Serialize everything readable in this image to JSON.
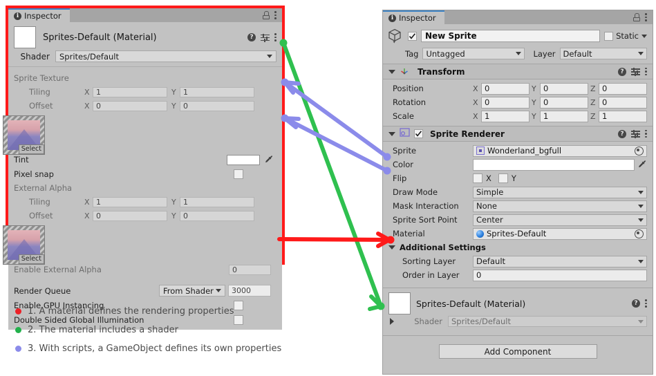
{
  "left_panel": {
    "tab_label": "Inspector",
    "material_title": "Sprites-Default (Material)",
    "shader_label": "Shader",
    "shader_value": "Sprites/Default",
    "sections": {
      "sprite_texture": {
        "label": "Sprite Texture",
        "tiling_label": "Tiling",
        "tiling_x_axis": "X",
        "tiling_x": "1",
        "tiling_y_axis": "Y",
        "tiling_y": "1",
        "offset_label": "Offset",
        "offset_x_axis": "X",
        "offset_x": "0",
        "offset_y_axis": "Y",
        "offset_y": "0",
        "select_label": "Select"
      },
      "tint": {
        "label": "Tint",
        "value": ""
      },
      "pixel_snap": {
        "label": "Pixel snap",
        "checked": false
      },
      "external_alpha": {
        "label": "External Alpha",
        "tiling_label": "Tiling",
        "tiling_x_axis": "X",
        "tiling_x": "1",
        "tiling_y_axis": "Y",
        "tiling_y": "1",
        "offset_label": "Offset",
        "offset_x_axis": "X",
        "offset_x": "0",
        "offset_y_axis": "Y",
        "offset_y": "0",
        "select_label": "Select"
      },
      "enable_external_alpha": {
        "label": "Enable External Alpha",
        "value": "0"
      },
      "render_queue": {
        "label": "Render Queue",
        "mode": "From Shader",
        "value": "3000"
      },
      "enable_gpu_instancing": {
        "label": "Enable GPU Instancing",
        "checked": false
      },
      "double_sided_gi": {
        "label": "Double Sided Global Illumination",
        "checked": false
      }
    }
  },
  "right_panel": {
    "tab_label": "Inspector",
    "gameobject": {
      "name": "New Sprite",
      "enabled": true,
      "static_label": "Static",
      "static_checked": false,
      "tag_label": "Tag",
      "tag_value": "Untagged",
      "layer_label": "Layer",
      "layer_value": "Default"
    },
    "transform": {
      "title": "Transform",
      "rows": [
        {
          "label": "Position",
          "x": "0",
          "y": "0",
          "z": "0"
        },
        {
          "label": "Rotation",
          "x": "0",
          "y": "0",
          "z": "0"
        },
        {
          "label": "Scale",
          "x": "1",
          "y": "1",
          "z": "1"
        }
      ],
      "axis_x": "X",
      "axis_y": "Y",
      "axis_z": "Z"
    },
    "sprite_renderer": {
      "title": "Sprite Renderer",
      "enabled": true,
      "sprite_label": "Sprite",
      "sprite_value": "Wonderland_bgfull",
      "color_label": "Color",
      "color_value": "",
      "flip_label": "Flip",
      "flip_x_label": "X",
      "flip_y_label": "Y",
      "flip_x_checked": false,
      "flip_y_checked": false,
      "draw_mode_label": "Draw Mode",
      "draw_mode_value": "Simple",
      "mask_interaction_label": "Mask Interaction",
      "mask_interaction_value": "None",
      "sprite_sort_point_label": "Sprite Sort Point",
      "sprite_sort_point_value": "Center",
      "material_label": "Material",
      "material_value": "Sprites-Default",
      "additional_settings_label": "Additional Settings",
      "sorting_layer_label": "Sorting Layer",
      "sorting_layer_value": "Default",
      "order_in_layer_label": "Order in Layer",
      "order_in_layer_value": "0"
    },
    "material_preview": {
      "title": "Sprites-Default (Material)",
      "shader_label": "Shader",
      "shader_value": "Sprites/Default"
    },
    "add_component_label": "Add Component"
  },
  "legend": {
    "items": [
      {
        "color": "#ec2027",
        "text": "1. A material defines the rendering properties"
      },
      {
        "color": "#22b14c",
        "text": "2. The material includes a shader"
      },
      {
        "color": "#8b8bea",
        "text": "3. With scripts, a GameObject defines its own properties"
      }
    ]
  },
  "colors": {
    "annotation_red": "#ff1a1a",
    "annotation_green": "#2fc04f",
    "annotation_purple": "#8b8bea",
    "panel_bg": "#c2c2c2"
  }
}
